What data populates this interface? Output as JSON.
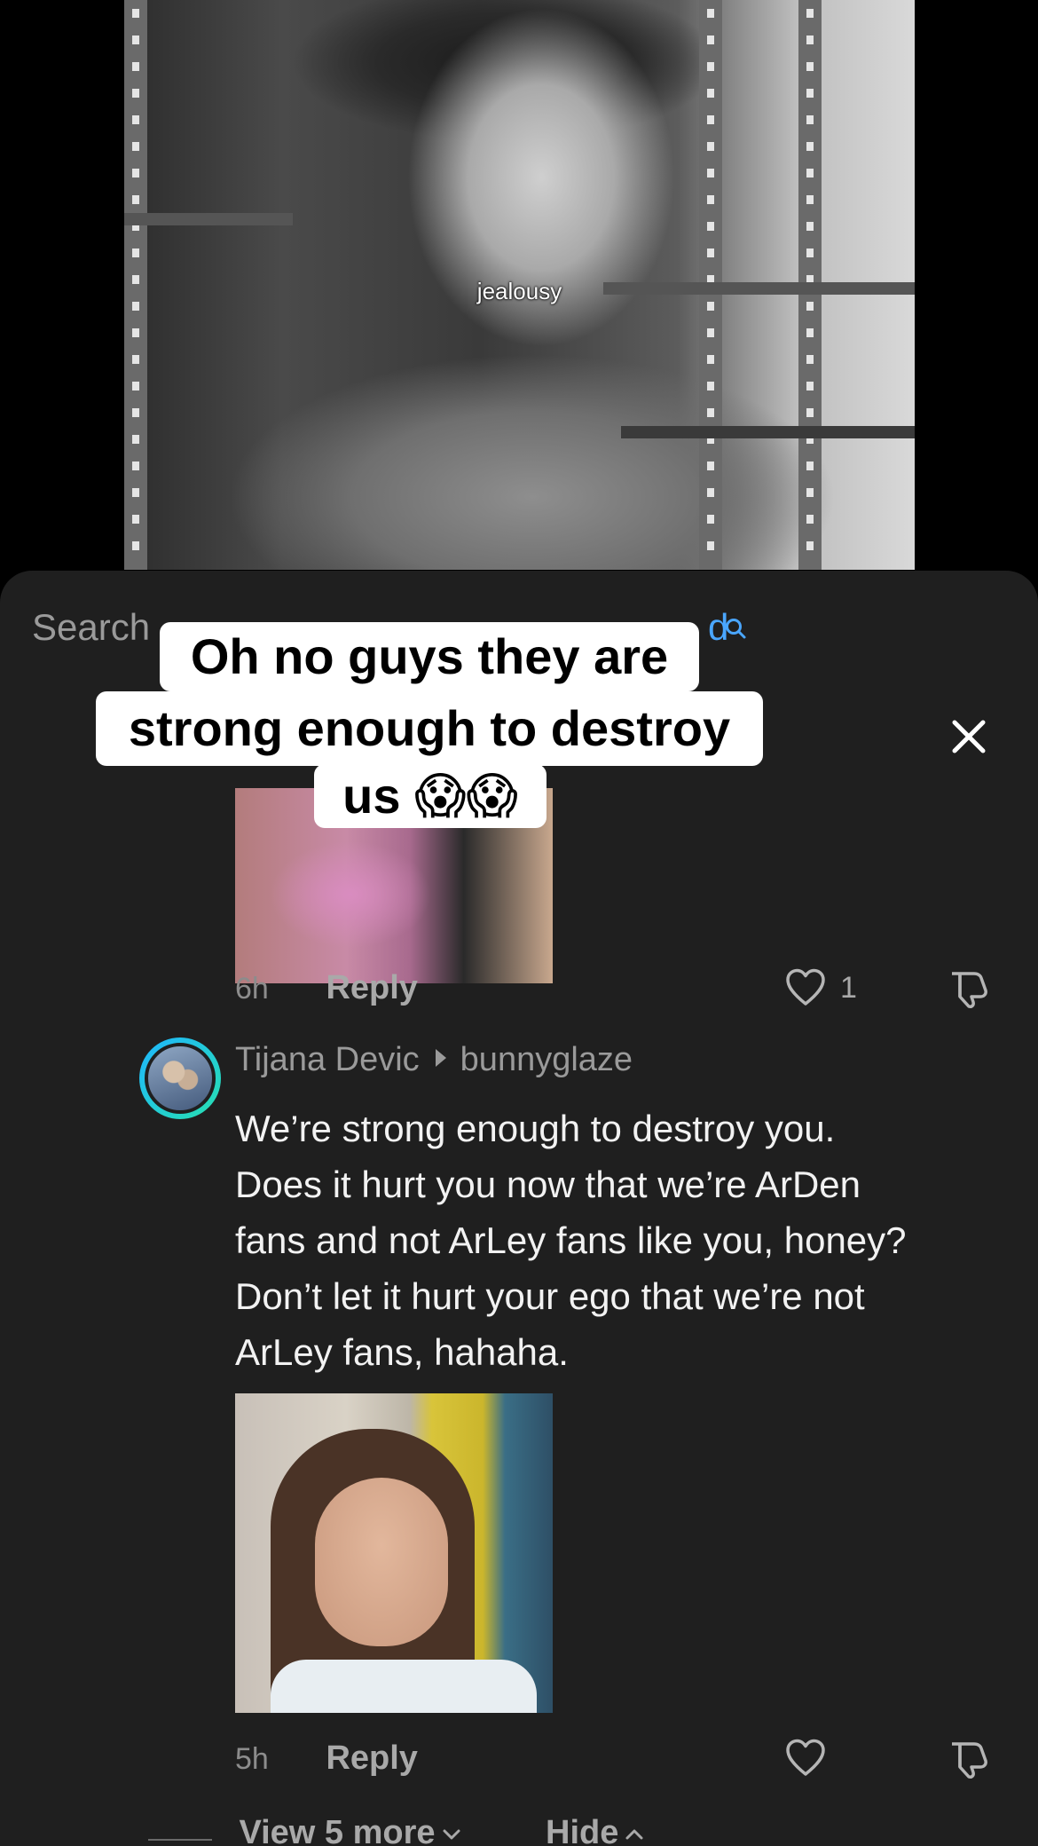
{
  "video": {
    "caption": "jealousy"
  },
  "sheet": {
    "search_label": "Search",
    "search_suggestion": "d"
  },
  "sticker": {
    "line1": "Oh no guys they are",
    "line2": "strong enough to destroy",
    "line3": "us 😱😱"
  },
  "comments": [
    {
      "time": "6h",
      "reply_label": "Reply",
      "like_count": "1"
    },
    {
      "author": "Tijana Devic",
      "reply_to": "bunnyglaze",
      "text": "We’re strong enough to destroy you.\nDoes it hurt you now that we’re ArDen\nfans and not ArLey fans like you, honey?\nDon’t let it hurt your ego that we’re not\nArLey fans, hahaha.",
      "time": "5h",
      "reply_label": "Reply"
    }
  ],
  "thread": {
    "view_more_label": "View 5 more",
    "hide_label": "Hide"
  },
  "icons": {
    "search": "search-icon",
    "close": "close-icon",
    "like": "heart-icon",
    "dislike": "thumbs-down-icon",
    "view_more": "chevron-down-icon",
    "hide": "chevron-up-icon"
  },
  "colors": {
    "sheet_bg": "#1f1f1f",
    "search_accent": "#4aa6ff",
    "avatar_ring": "#1fb6ff"
  }
}
